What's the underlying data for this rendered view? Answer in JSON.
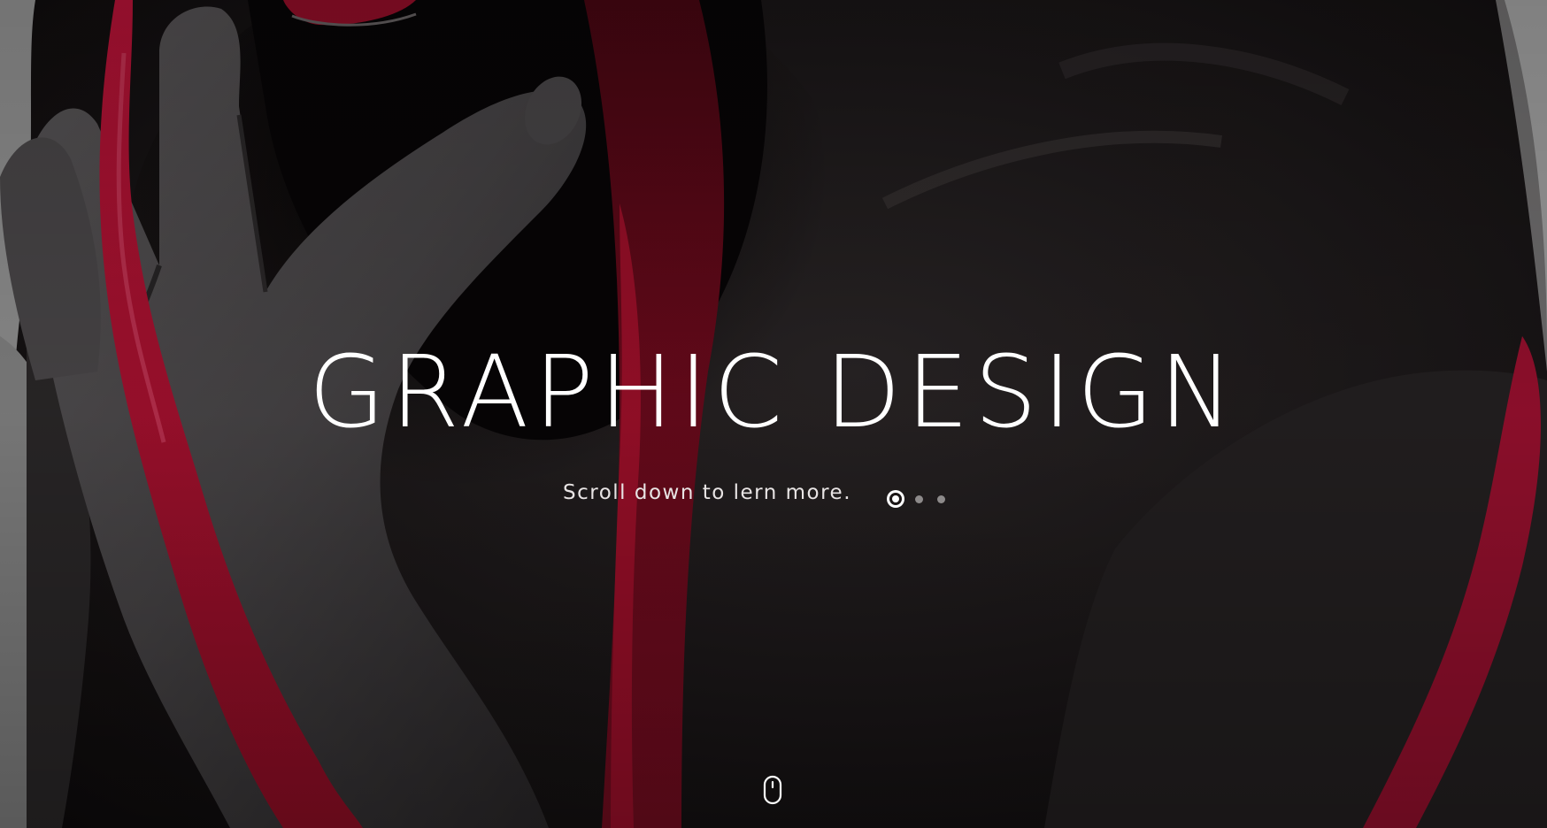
{
  "hero": {
    "title": "GRAPHIC DESIGN",
    "subtitle": "Scroll down to lern more.",
    "slides": {
      "count": 3,
      "active_index": 0
    },
    "scroll_icon": "mouse-icon"
  },
  "colors": {
    "text": "#ffffff",
    "paint_accent": "#b5132f",
    "skin": "#2e2a2b",
    "background_light": "#9a9a9a"
  }
}
